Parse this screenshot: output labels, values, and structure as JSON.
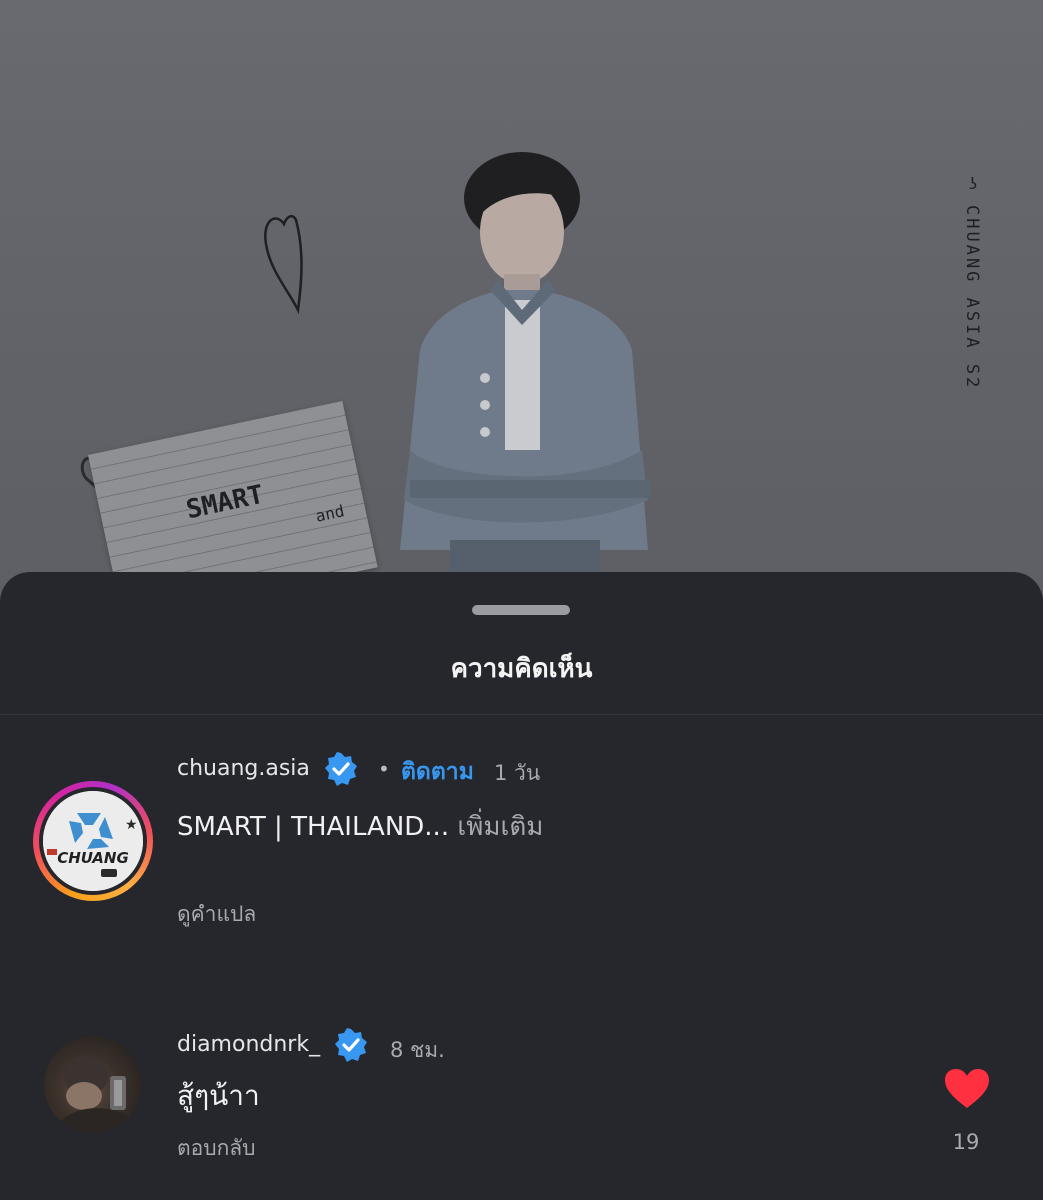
{
  "backdrop": {
    "vertical_text": "CHUANG ASIA S2",
    "note_title": "SMART",
    "note_sub": "and"
  },
  "sheet": {
    "title": "ความคิดเห็น"
  },
  "caption_comment": {
    "username": "chuang.asia",
    "follow_label": "ติดตาม",
    "time": "1 วัน",
    "text": "SMART | THAILAND...",
    "more_label": "เพิ่มเติม",
    "translate_label": "ดูคำแปล",
    "avatar_text": "CHUANG"
  },
  "reply_comment": {
    "username": "diamondnrk_",
    "time": "8 ชม.",
    "text": "สู้ๆน้าา",
    "reply_label": "ตอบกลับ",
    "like_count": "19",
    "liked": true
  },
  "colors": {
    "accent_blue": "#3797f0",
    "like_red": "#ff3040",
    "sheet_bg": "#25272c"
  }
}
